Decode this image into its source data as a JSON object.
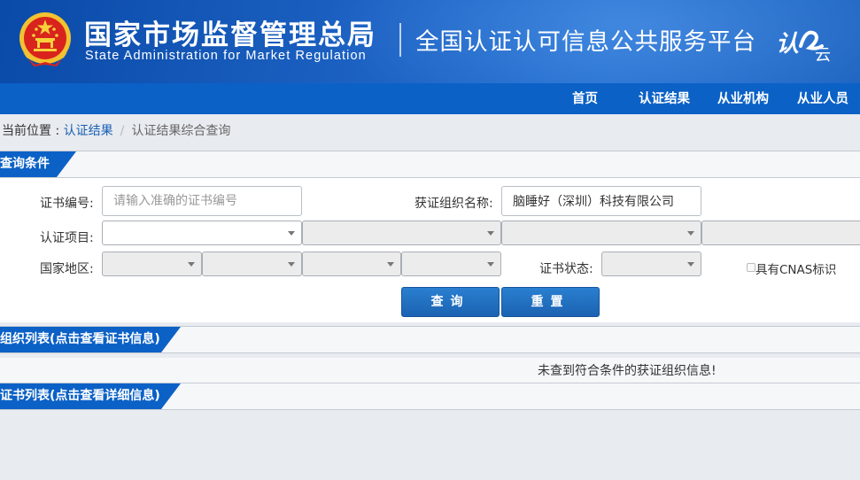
{
  "header": {
    "agency_cn": "国家市场监督管理总局",
    "agency_en": "State Administration  for  Market Regulation",
    "platform_title": "全国认证认可信息公共服务平台",
    "logo_text_1": "认",
    "logo_text_2": "云"
  },
  "nav": {
    "items": [
      {
        "label": "首页"
      },
      {
        "label": "认证结果"
      },
      {
        "label": "从业机构"
      },
      {
        "label": "从业人员"
      }
    ]
  },
  "breadcrumb": {
    "prefix": "当前位置 : ",
    "link": "认证结果",
    "separator": "/",
    "current": "认证结果综合查询"
  },
  "query": {
    "section_title": "查询条件",
    "cert_no_label": "证书编号:",
    "cert_no_placeholder": "请输入准确的证书编号",
    "org_name_label": "获证组织名称:",
    "org_name_value": "脑睡好（深圳）科技有限公司",
    "project_label": "认证项目:",
    "region_label": "国家地区:",
    "status_label": "证书状态:",
    "cnas_label": "具有CNAS标识",
    "cnas_checked": false,
    "search_button": "查询",
    "reset_button": "重置"
  },
  "org_list": {
    "section_title": "组织列表(点击查看证书信息)",
    "empty_message": "未查到符合条件的获证组织信息!"
  },
  "cert_list": {
    "section_title": "证书列表(点击查看详细信息)"
  },
  "colors": {
    "header_bg": "#1d63c4",
    "nav_bg": "#0b61c6",
    "tab_bg": "#0b61c6",
    "button_bg": "#1f6cbf",
    "link": "#1a5fb4"
  }
}
